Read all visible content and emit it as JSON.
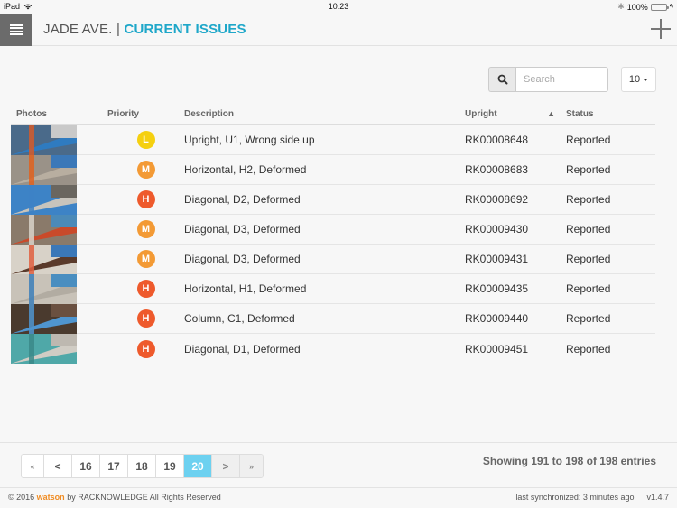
{
  "status_bar": {
    "device": "iPad",
    "time": "10:23",
    "battery": "100%"
  },
  "header": {
    "site": "JADE AVE.",
    "separator": "|",
    "section": "CURRENT ISSUES",
    "menu_icon": "hamburger-menu-icon",
    "add_icon": "plus-icon"
  },
  "toolbar": {
    "search_placeholder": "Search",
    "search_value": "",
    "page_size": "10"
  },
  "table": {
    "columns": {
      "photos": "Photos",
      "priority": "Priority",
      "description": "Description",
      "upright": "Upright",
      "status": "Status"
    },
    "sort_indicator": "^",
    "rows": [
      {
        "priority": "L",
        "description": "Upright, U1, Wrong side up",
        "upright": "RK00008648",
        "status": "Reported"
      },
      {
        "priority": "M",
        "description": "Horizontal, H2, Deformed",
        "upright": "RK00008683",
        "status": "Reported"
      },
      {
        "priority": "H",
        "description": "Diagonal, D2, Deformed",
        "upright": "RK00008692",
        "status": "Reported"
      },
      {
        "priority": "M",
        "description": "Diagonal, D3, Deformed",
        "upright": "RK00009430",
        "status": "Reported"
      },
      {
        "priority": "M",
        "description": "Diagonal, D3, Deformed",
        "upright": "RK00009431",
        "status": "Reported"
      },
      {
        "priority": "H",
        "description": "Horizontal, H1, Deformed",
        "upright": "RK00009435",
        "status": "Reported"
      },
      {
        "priority": "H",
        "description": "Column, C1, Deformed",
        "upright": "RK00009440",
        "status": "Reported"
      },
      {
        "priority": "H",
        "description": "Diagonal, D1, Deformed",
        "upright": "RK00009451",
        "status": "Reported"
      }
    ]
  },
  "priority_colors": {
    "L": "#f5d010",
    "M": "#f39a35",
    "H": "#ee5a2c"
  },
  "pagination": {
    "first": "«",
    "prev": "<",
    "pages": [
      "16",
      "17",
      "18",
      "19",
      "20"
    ],
    "active": "20",
    "next": ">",
    "last": "»",
    "summary": "Showing 191 to 198 of 198 entries"
  },
  "footer": {
    "copyright": "© 2016",
    "brand": "watson",
    "by": "by RACKNOWLEDGE All Rights Reserved",
    "sync": "last synchronized: 3 minutes ago",
    "version": "v1.4.7"
  },
  "colors": {
    "accent": "#1ea7c9",
    "brand": "#f08c23",
    "active_page": "#6dd1f0"
  }
}
